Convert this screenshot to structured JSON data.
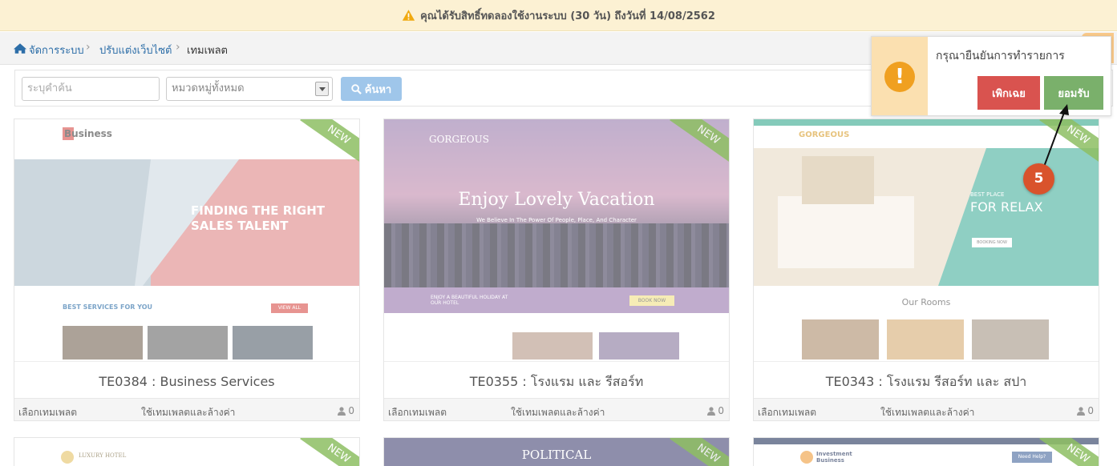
{
  "banner": {
    "text": "คุณได้รับสิทธิ์ทดลองใช้งานระบบ (30 วัน) ถึงวันที่ 14/08/2562"
  },
  "breadcrumb": {
    "items": [
      "จัดการระบบ",
      "ปรับแต่งเว็บไซต์",
      "เทมเพลต"
    ]
  },
  "search": {
    "keyword_placeholder": "ระบุคำค้น",
    "category_value": "หมวดหมู่ทั้งหมด",
    "button_label": "ค้นหา"
  },
  "templates": [
    {
      "title": "TE0384 : Business Services",
      "badge": "NEW",
      "select_label": "เลือกเทมเพลต",
      "use_label": "ใช้เทมเพลตและล้างค่า",
      "count": "0",
      "preview": {
        "brand": "Business",
        "headline1": "FINDING THE RIGHT",
        "headline2": "SALES TALENT",
        "section": "BEST SERVICES FOR YOU",
        "cta": "VIEW ALL"
      }
    },
    {
      "title": "TE0355 : โรงแรม และ รีสอร์ท",
      "badge": "NEW",
      "select_label": "เลือกเทมเพลต",
      "use_label": "ใช้เทมเพลตและล้างค่า",
      "count": "0",
      "preview": {
        "brand": "GORGEOUS",
        "headline1": "Enjoy Lovely Vacation",
        "headline2": "We Believe In The Power Of People, Place, And Character",
        "section": "ENJOY A BEAUTIFUL HOLIDAY AT OUR HOTEL",
        "cta": "BOOK NOW"
      }
    },
    {
      "title": "TE0343 : โรงแรม รีสอร์ท และ สปา",
      "badge": "NEW",
      "select_label": "เลือกเทมเพลต",
      "use_label": "ใช้เทมเพลตและล้างค่า",
      "count": "0",
      "preview": {
        "brand": "GORGEOUS",
        "headline1": "BEST PLACE",
        "headline2": "FOR RELAX",
        "section": "Our Rooms",
        "cta": "BOOKING NOW"
      }
    },
    {
      "badge": "NEW",
      "preview": {
        "brand": "LUXURY HOTEL"
      }
    },
    {
      "badge": "NEW",
      "preview": {
        "brand": "POLITICAL"
      }
    },
    {
      "badge": "NEW",
      "preview": {
        "brand": "Investment Business",
        "cta": "Need Help?"
      }
    }
  ],
  "confirm_popup": {
    "message": "กรุณายืนยันการทำรายการ",
    "cancel_label": "เพิกเฉย",
    "accept_label": "ยอมรับ"
  },
  "step_marker": {
    "number": "5"
  },
  "colors": {
    "accept": "#7ab06b",
    "cancel": "#d9534f",
    "step": "#d9532c",
    "ribbon": "#8ebf63"
  }
}
